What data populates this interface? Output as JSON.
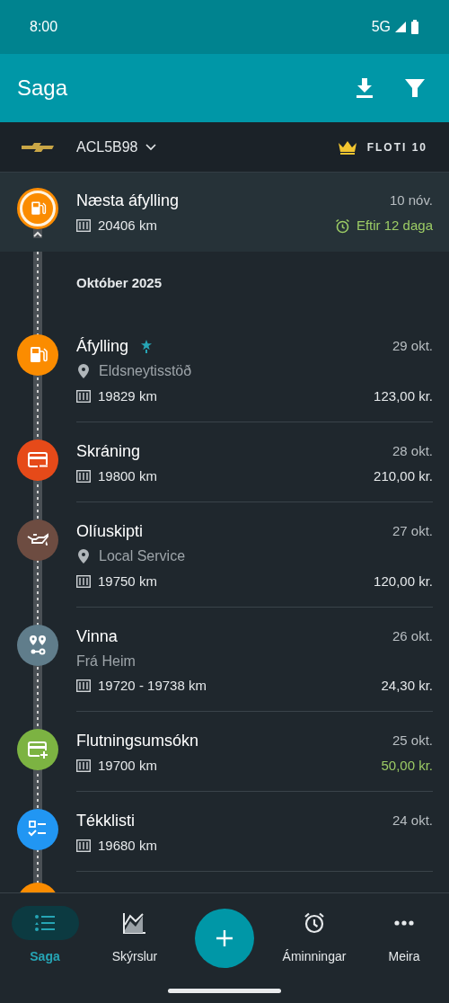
{
  "status_bar": {
    "time": "8:00",
    "network": "5G"
  },
  "app_bar": {
    "title": "Saga"
  },
  "vehicle": {
    "plate": "ACL5B98",
    "plan": "FLOTI 10"
  },
  "next_fill": {
    "kind": "fuel",
    "color": "#fb8c00",
    "title": "Næsta áfylling",
    "date": "10 nóv.",
    "odometer": "20406 km",
    "due": "Eftir 12 daga"
  },
  "month": "Október 2025",
  "entries": [
    {
      "kind": "fuel",
      "color": "#fb8c00",
      "title": "Áfylling",
      "starred": true,
      "date": "29 okt.",
      "location": "Eldsneytisstöð",
      "odometer": "19829 km",
      "amount": "123,00 kr.",
      "income": false
    },
    {
      "kind": "expense",
      "color": "#e64a19",
      "title": "Skráning",
      "starred": false,
      "date": "28 okt.",
      "odometer": "19800 km",
      "amount": "210,00 kr.",
      "income": false
    },
    {
      "kind": "service",
      "color": "#6d4c41",
      "title": "Olíuskipti",
      "starred": false,
      "date": "27 okt.",
      "location": "Local Service",
      "odometer": "19750 km",
      "amount": "120,00 kr.",
      "income": false
    },
    {
      "kind": "trip",
      "color": "#607d8b",
      "title": "Vinna",
      "starred": false,
      "date": "26 okt.",
      "note": "Frá Heim",
      "odometer": "19720 - 19738 km",
      "amount": "24,30 kr.",
      "income": false
    },
    {
      "kind": "income",
      "color": "#7cb342",
      "title": "Flutningsumsókn",
      "starred": false,
      "date": "25 okt.",
      "odometer": "19700 km",
      "amount": "50,00 kr.",
      "income": true
    },
    {
      "kind": "checklist",
      "color": "#2196f3",
      "title": "Tékklisti",
      "starred": false,
      "date": "24 okt.",
      "odometer": "19680 km"
    }
  ],
  "nav": [
    {
      "kind": "history",
      "label": "Saga",
      "selected": true
    },
    {
      "kind": "reports",
      "label": "Skýrslur",
      "selected": false
    },
    {
      "kind": "reminders",
      "label": "Áminningar",
      "selected": false
    },
    {
      "kind": "more",
      "label": "Meira",
      "selected": false
    }
  ]
}
